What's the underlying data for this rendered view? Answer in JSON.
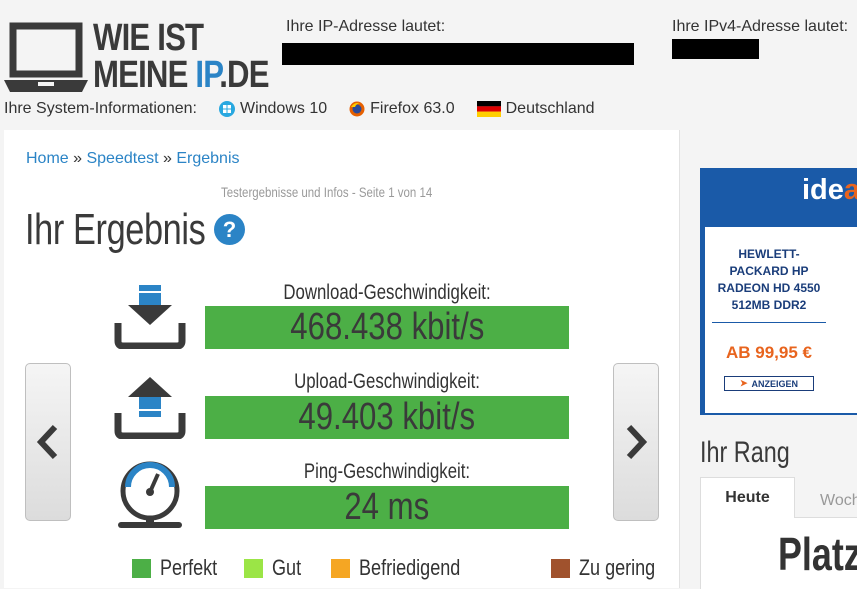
{
  "header": {
    "logo_line1": "WIE IST",
    "logo_line2_prefix": "MEINE ",
    "logo_line2_ip": "IP",
    "logo_line2_suffix": ".DE",
    "ip_label": "Ihre IP-Adresse lautet:",
    "ipv4_label": "Ihre IPv4-Adresse lautet:"
  },
  "sysinfo": {
    "label": "Ihre System-Informationen:",
    "os": "Windows 10",
    "browser": "Firefox 63.0",
    "country": "Deutschland"
  },
  "breadcrumb": {
    "home": "Home",
    "sep1": " » ",
    "speedtest": "Speedtest",
    "sep2": " » ",
    "result": "Ergebnis"
  },
  "main": {
    "subtitle": "Testergebnisse und Infos - Seite 1 von 14",
    "title": "Ihr Ergebnis",
    "help_glyph": "?"
  },
  "metrics": [
    {
      "label": "Download-Geschwindigkeit:",
      "value": "468.438 kbit/s",
      "icon": "download-icon"
    },
    {
      "label": "Upload-Geschwindigkeit:",
      "value": "49.403 kbit/s",
      "icon": "upload-icon"
    },
    {
      "label": "Ping-Geschwindigkeit:",
      "value": "24 ms",
      "icon": "gauge-icon"
    }
  ],
  "legend": [
    {
      "label": "Perfekt",
      "color": "#4caf46"
    },
    {
      "label": "Gut",
      "color": "#9be546"
    },
    {
      "label": "Befriedigend",
      "color": "#f5a623"
    },
    {
      "label": "Zu gering",
      "color": "#a0522d"
    }
  ],
  "ad": {
    "brand_prefix": "ide",
    "brand_o": "a",
    "product": "HEWLETT-PACKARD HP RADEON HD 4550 512MB DDR2",
    "price": "AB 99,95 €",
    "button": "ANZEIGEN"
  },
  "rang": {
    "title": "Ihr Rang",
    "tab_today": "Heute",
    "tab_week": "Woche",
    "platz": "Platz:"
  },
  "colors": {
    "accent": "#2b84c6",
    "result_green": "#4caf46",
    "ad_blue": "#1a5aa8",
    "ad_orange": "#e8641e"
  }
}
